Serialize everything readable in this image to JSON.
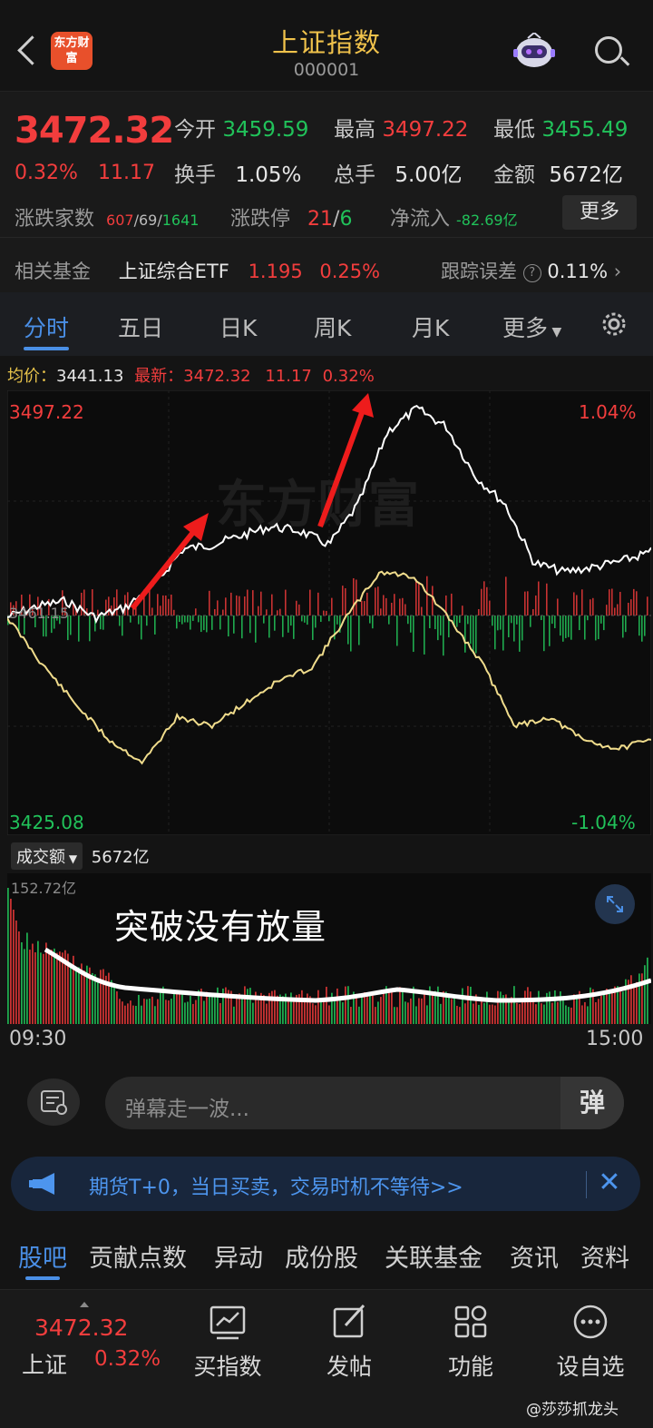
{
  "header": {
    "logo_text": "东方财富",
    "title": "上证指数",
    "code": "000001"
  },
  "quote": {
    "price": "3472.32",
    "change_pct": "0.32%",
    "change": "11.17",
    "open_label": "今开",
    "open": "3459.59",
    "high_label": "最高",
    "high": "3497.22",
    "low_label": "最低",
    "low": "3455.49",
    "turnover_label": "换手",
    "turnover": "1.05%",
    "volume_label": "总手",
    "volume": "5.00亿",
    "amount_label": "金额",
    "amount": "5672亿",
    "breadth_label": "涨跌家数",
    "breadth_up": "607",
    "breadth_flat": "69",
    "breadth_down": "1641",
    "limit_label": "涨跌停",
    "limit_up": "21",
    "limit_down": "6",
    "netflow_label": "净流入",
    "netflow": "-82.69亿",
    "more_button": "更多",
    "fund_label": "相关基金",
    "fund_name": "上证综合ETF",
    "fund_price": "1.195",
    "fund_pct": "0.25%",
    "tracking_label": "跟踪误差",
    "tracking_value": "0.11%"
  },
  "tabs": [
    "分时",
    "五日",
    "日K",
    "周K",
    "月K",
    "更多"
  ],
  "intraday": {
    "avg_label": "均价：",
    "avg": "3441.13",
    "latest_label": "最新：",
    "latest": "3472.32",
    "latest_chg": "11.17",
    "latest_pct": "0.32%",
    "top_price": "3497.22",
    "top_pct": "1.04%",
    "bottom_price": "3425.08",
    "bottom_pct": "-1.04%",
    "mid_price": "3461.15",
    "watermark": "东方财富"
  },
  "volume": {
    "selector_label": "成交额",
    "total": "5672亿",
    "max_label": "152.72亿",
    "annotation": "突破没有放量",
    "time_start": "09:30",
    "time_end": "15:00"
  },
  "danmu": {
    "placeholder": "弹幕走一波...",
    "button": "弹"
  },
  "ad": {
    "text": "期货T+0，当日买卖，交易时机不等待>>",
    "close": "✕"
  },
  "subtabs": [
    "股吧",
    "贡献点数",
    "异动",
    "成份股",
    "关联基金",
    "资讯",
    "资料"
  ],
  "bottombar": {
    "price": "3472.32",
    "name": "上证",
    "pct": "0.32%",
    "items": [
      "买指数",
      "发帖",
      "功能",
      "设自选"
    ]
  },
  "weibo_watermark": "@莎莎抓龙头",
  "colors": {
    "up": "#f23d3d",
    "down": "#21c25a",
    "accent": "#4a8fe6",
    "title": "#f0c24b"
  }
}
